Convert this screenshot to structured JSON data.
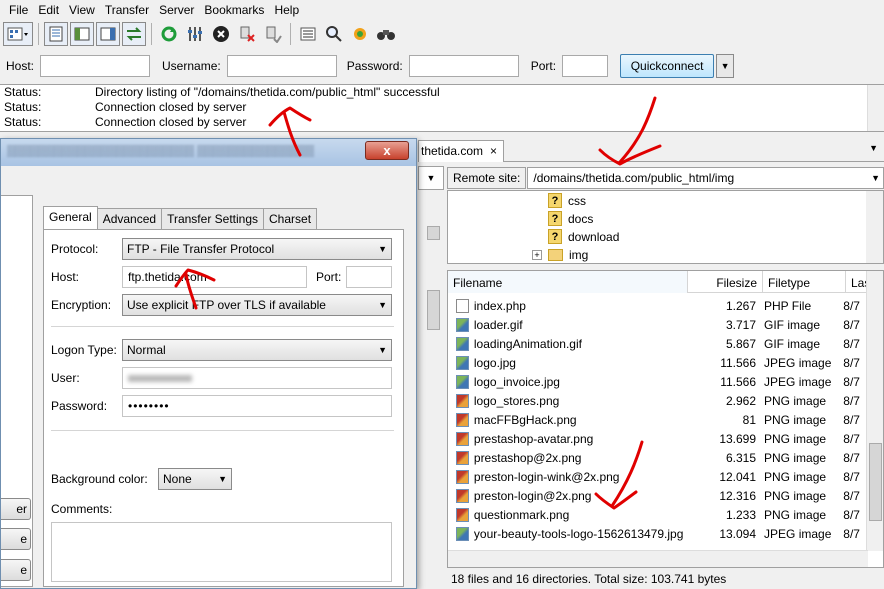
{
  "menu": [
    "File",
    "Edit",
    "View",
    "Transfer",
    "Server",
    "Bookmarks",
    "Help"
  ],
  "quickconnect": {
    "host_label": "Host:",
    "username_label": "Username:",
    "password_label": "Password:",
    "port_label": "Port:",
    "button_label": "Quickconnect"
  },
  "log": [
    {
      "k": "Status:",
      "v": "Directory listing of \"/domains/thetida.com/public_html\" successful"
    },
    {
      "k": "Status:",
      "v": "Connection closed by server"
    },
    {
      "k": "Status:",
      "v": "Connection closed by server"
    }
  ],
  "tab": {
    "label": "thetida.com",
    "close": "×"
  },
  "remote": {
    "label": "Remote site:",
    "path": "/domains/thetida.com/public_html/img",
    "tree": [
      {
        "name": "css",
        "icon": "question-folder-icon"
      },
      {
        "name": "docs",
        "icon": "question-folder-icon"
      },
      {
        "name": "download",
        "icon": "question-folder-icon"
      },
      {
        "name": "img",
        "icon": "folder-icon"
      }
    ]
  },
  "filelist": {
    "headers": [
      "Filename",
      "Filesize",
      "Filetype",
      "Las"
    ],
    "rows": [
      {
        "name": "index.php",
        "size": "1.267",
        "type": "PHP File",
        "date": "8/7",
        "icon": "php"
      },
      {
        "name": "loader.gif",
        "size": "3.717",
        "type": "GIF image",
        "date": "8/7",
        "icon": "img"
      },
      {
        "name": "loadingAnimation.gif",
        "size": "5.867",
        "type": "GIF image",
        "date": "8/7",
        "icon": "img"
      },
      {
        "name": "logo.jpg",
        "size": "11.566",
        "type": "JPEG image",
        "date": "8/7",
        "icon": "img"
      },
      {
        "name": "logo_invoice.jpg",
        "size": "11.566",
        "type": "JPEG image",
        "date": "8/7",
        "icon": "img"
      },
      {
        "name": "logo_stores.png",
        "size": "2.962",
        "type": "PNG image",
        "date": "8/7",
        "icon": "png"
      },
      {
        "name": "macFFBgHack.png",
        "size": "81",
        "type": "PNG image",
        "date": "8/7",
        "icon": "png"
      },
      {
        "name": "prestashop-avatar.png",
        "size": "13.699",
        "type": "PNG image",
        "date": "8/7",
        "icon": "png"
      },
      {
        "name": "prestashop@2x.png",
        "size": "6.315",
        "type": "PNG image",
        "date": "8/7",
        "icon": "png"
      },
      {
        "name": "preston-login-wink@2x.png",
        "size": "12.041",
        "type": "PNG image",
        "date": "8/7",
        "icon": "png"
      },
      {
        "name": "preston-login@2x.png",
        "size": "12.316",
        "type": "PNG image",
        "date": "8/7",
        "icon": "png"
      },
      {
        "name": "questionmark.png",
        "size": "1.233",
        "type": "PNG image",
        "date": "8/7",
        "icon": "png"
      },
      {
        "name": "your-beauty-tools-logo-1562613479.jpg",
        "size": "13.094",
        "type": "JPEG image",
        "date": "8/7",
        "icon": "img"
      }
    ],
    "status": "18 files and 16 directories. Total size: 103.741 bytes"
  },
  "dialog": {
    "close": "x",
    "side_buttons": [
      "er",
      "e",
      "e"
    ],
    "tabs": [
      "General",
      "Advanced",
      "Transfer Settings",
      "Charset"
    ],
    "protocol_label": "Protocol:",
    "protocol_value": "FTP - File Transfer Protocol",
    "host_label": "Host:",
    "host_value": "ftp.thetida.com",
    "port_label": "Port:",
    "encryption_label": "Encryption:",
    "encryption_value": "Use explicit FTP over TLS if available",
    "logon_label": "Logon Type:",
    "logon_value": "Normal",
    "user_label": "User:",
    "password_label": "Password:",
    "password_value": "••••••••",
    "bg_label": "Background color:",
    "bg_value": "None",
    "comments_label": "Comments:"
  },
  "colors": {
    "annotation": "#e00000",
    "accent": "#3c7fb1"
  }
}
